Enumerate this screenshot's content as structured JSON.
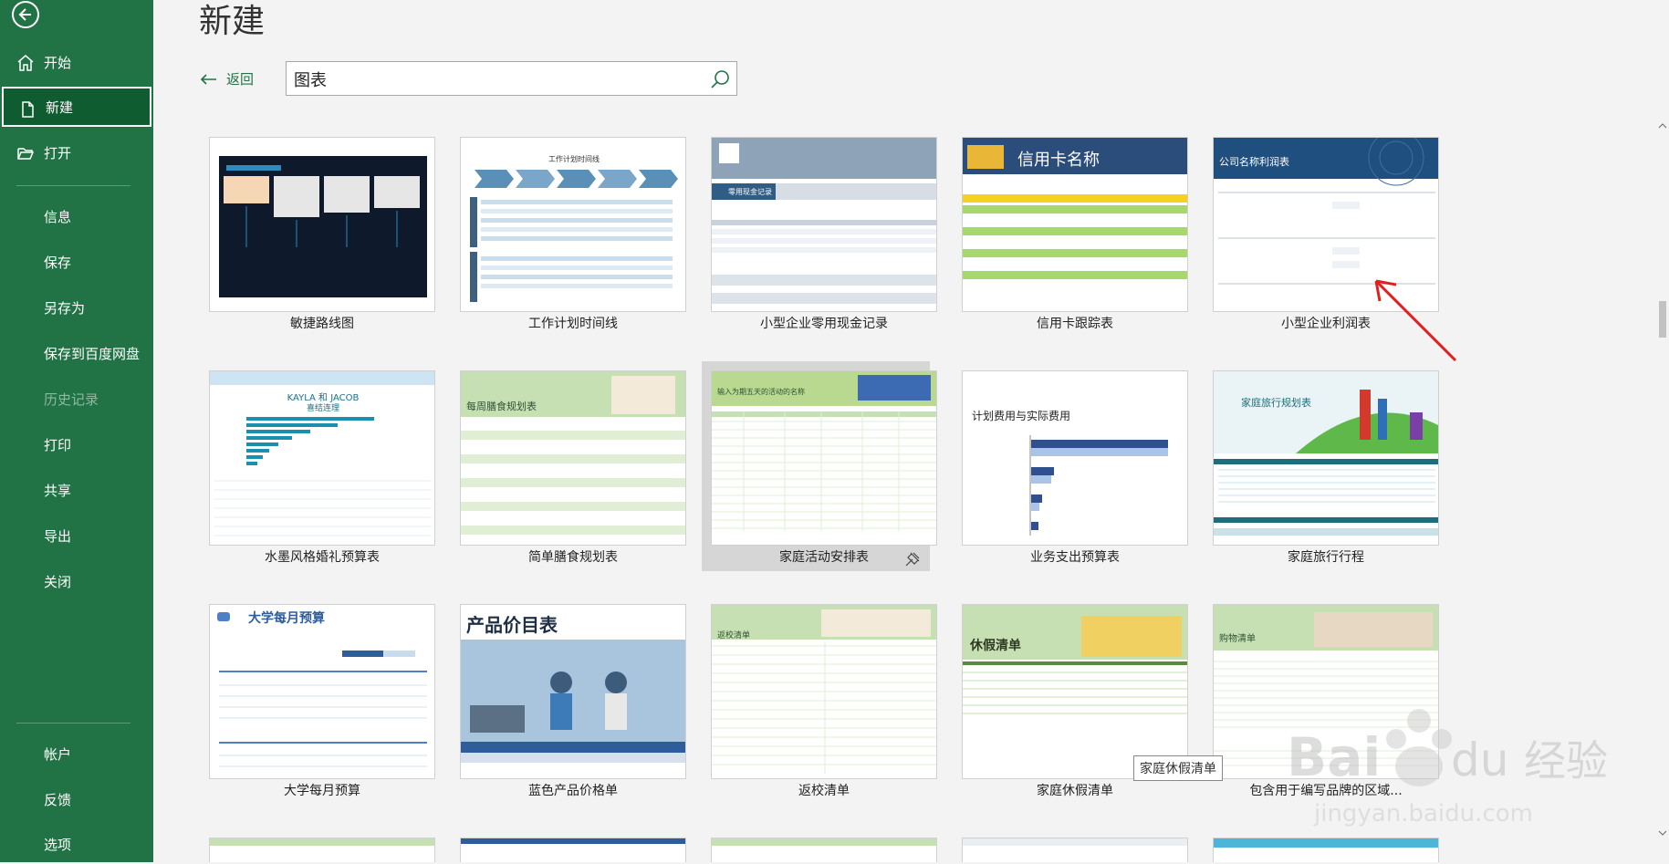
{
  "sidebar": {
    "items": [
      {
        "label": "开始"
      },
      {
        "label": "新建"
      },
      {
        "label": "打开"
      },
      {
        "label": "信息"
      },
      {
        "label": "保存"
      },
      {
        "label": "另存为"
      },
      {
        "label": "保存到百度网盘"
      },
      {
        "label": "历史记录"
      },
      {
        "label": "打印"
      },
      {
        "label": "共享"
      },
      {
        "label": "导出"
      },
      {
        "label": "关闭"
      },
      {
        "label": "帐户"
      },
      {
        "label": "反馈"
      },
      {
        "label": "选项"
      }
    ]
  },
  "header": {
    "title": "新建",
    "back_label": "返回"
  },
  "search": {
    "value": "图表",
    "placeholder": ""
  },
  "templates": [
    {
      "title": "敏捷路线图"
    },
    {
      "title": "工作计划时间线"
    },
    {
      "title": "小型企业零用现金记录"
    },
    {
      "title": "信用卡跟踪表"
    },
    {
      "title": "小型企业利润表"
    },
    {
      "title": "水墨风格婚礼预算表"
    },
    {
      "title": "简单膳食规划表"
    },
    {
      "title": "家庭活动安排表"
    },
    {
      "title": "业务支出预算表"
    },
    {
      "title": "家庭旅行行程"
    },
    {
      "title": "大学每月预算"
    },
    {
      "title": "蓝色产品价格单"
    },
    {
      "title": "返校清单"
    },
    {
      "title": "家庭休假清单"
    },
    {
      "title": "包含用于编写品牌的区域..."
    }
  ],
  "thumb_text": {
    "t2_header": "工作计划时间线",
    "t3_band": "零用现金记录",
    "t4_header": "信用卡名称",
    "t5_header": "公司名称利润表",
    "t6_header": "KAYLA 和 JACOB",
    "t6_sub": "喜结连理",
    "t7_header": "每周膳食规划表",
    "t8_header": "输入为期五天的活动的名称",
    "t9_header": "计划费用与实际费用",
    "t10_header": "家庭旅行规划表",
    "t11_header": "大学每月预算",
    "t12_header": "产品价目表",
    "t13_header": "返校清单",
    "t14_header": "休假清单",
    "t15_header": "购物清单"
  },
  "tooltip": "家庭休假清单",
  "watermark": "Bai 经验",
  "watermark_sub": "jingyan.baidu.com",
  "colors": {
    "accent": "#217346",
    "sidebar_active": "#0e5c2f"
  }
}
